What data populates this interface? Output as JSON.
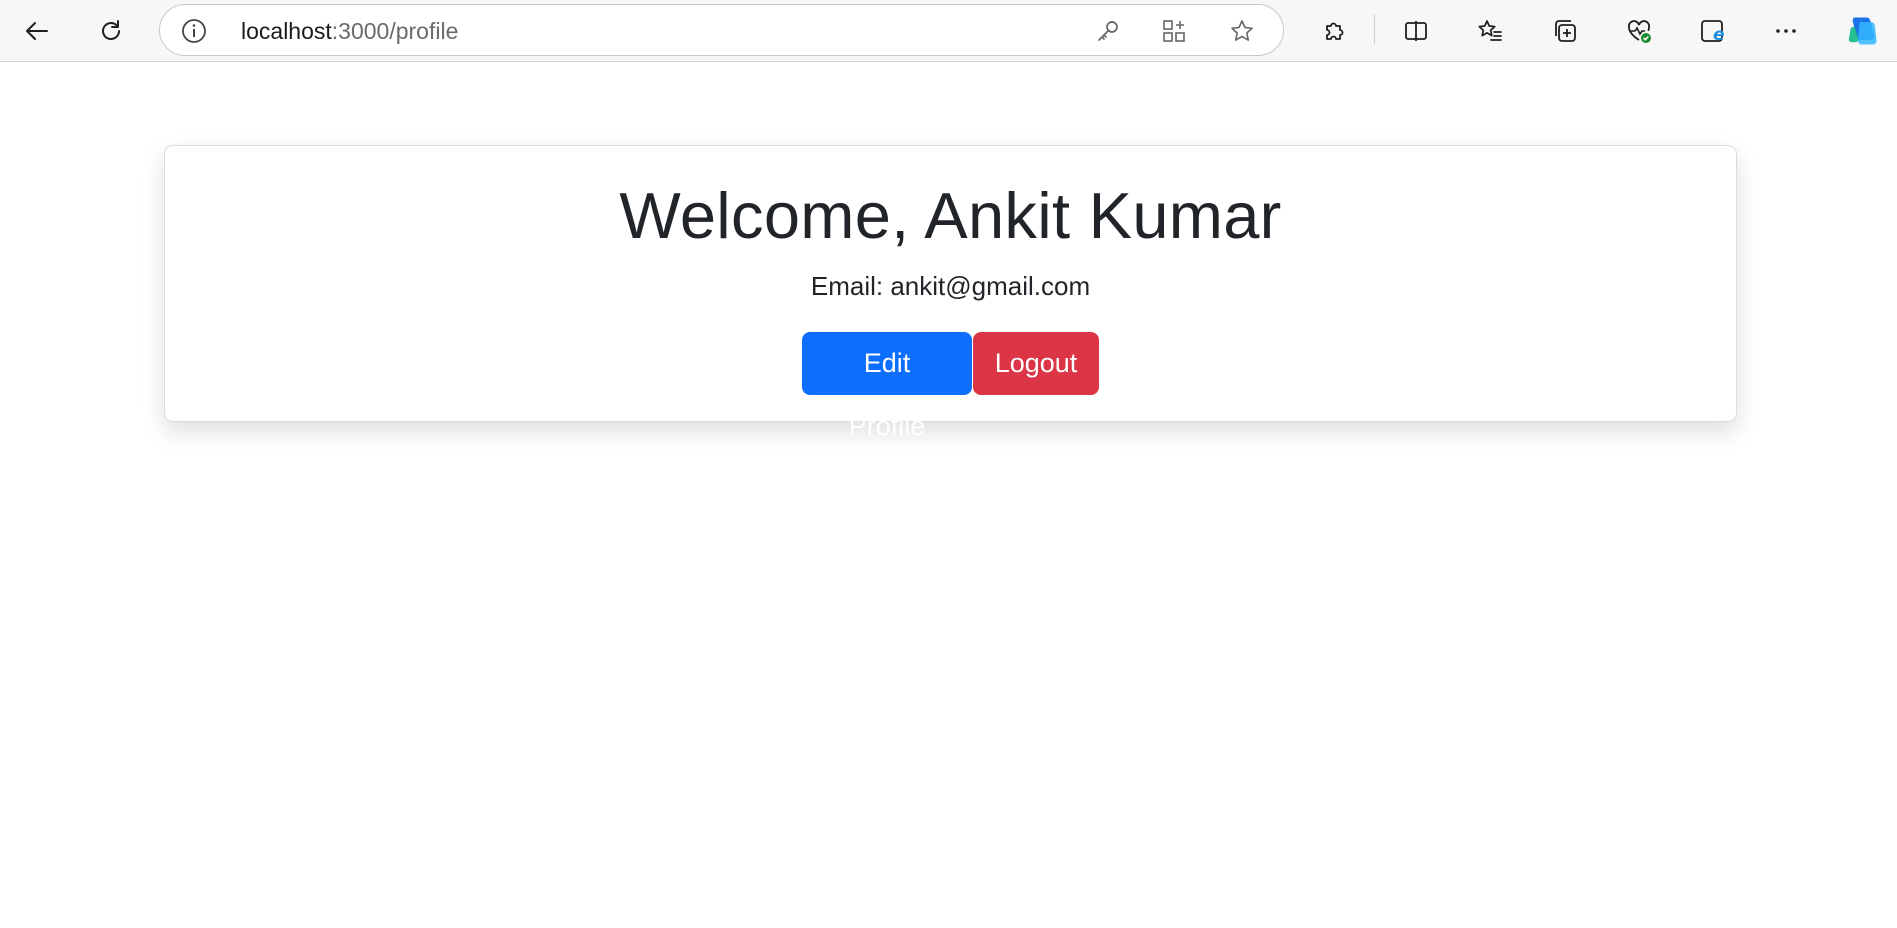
{
  "browser": {
    "url_host": "localhost",
    "url_path": ":3000/profile",
    "icons": {
      "back": "back-arrow-icon",
      "refresh": "refresh-icon",
      "site_info": "info-icon",
      "password": "key-icon",
      "apps": "apps-add-icon",
      "favorite": "star-icon",
      "extensions": "puzzle-icon",
      "split_screen": "split-screen-icon",
      "favorites": "favorites-list-icon",
      "collections": "collections-icon",
      "browser_essentials": "heart-pulse-icon",
      "ie_mode": "ie-mode-icon",
      "more": "more-dots-icon",
      "copilot": "copilot-icon"
    }
  },
  "profile": {
    "welcome": "Welcome, Ankit Kumar",
    "email": "Email: ankit@gmail.com",
    "edit_label": "Edit Profile",
    "logout_label": "Logout"
  },
  "colors": {
    "primary": "#0d6efd",
    "danger": "#dc3545",
    "text": "#212529"
  }
}
